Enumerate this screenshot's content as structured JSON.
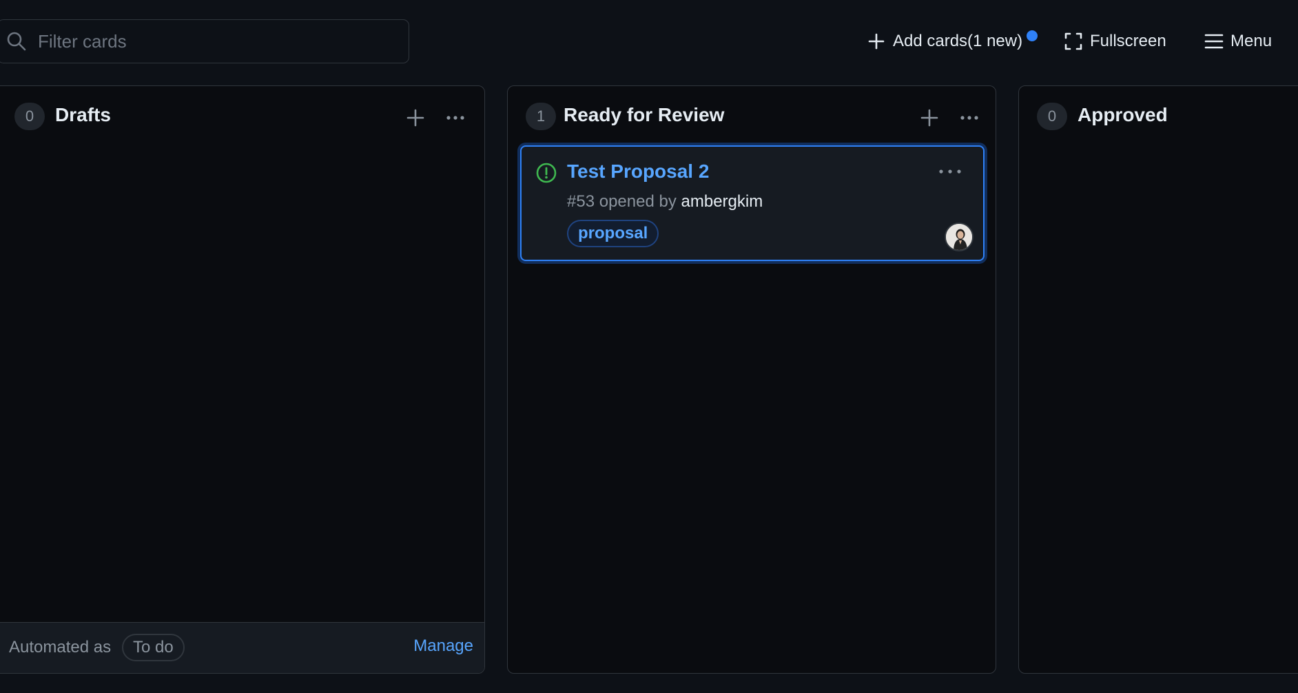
{
  "search": {
    "placeholder": "Filter cards",
    "value": "",
    "icon": "search-icon"
  },
  "toolbar": {
    "add_cards_label": "Add cards(1 new)",
    "fullscreen_label": "Fullscreen",
    "menu_label": "Menu",
    "notification_color": "#2f81f7"
  },
  "columns": [
    {
      "title": "Drafts",
      "count": "0",
      "footer": {
        "automated_label": "Automated as",
        "status": "To do",
        "manage_label": "Manage"
      }
    },
    {
      "title": "Ready for Review",
      "count": "1",
      "cards": [
        {
          "title": "Test Proposal 2",
          "number": "#53",
          "opened_by": "opened by",
          "author": "ambergkim",
          "label": "proposal",
          "status_icon": "issue-opened-icon",
          "status_color": "#3fb950"
        }
      ]
    },
    {
      "title": "Approved",
      "count": "0"
    }
  ],
  "colors": {
    "background": "#0d1117",
    "accent": "#2f81f7",
    "link": "#58a6ff"
  }
}
